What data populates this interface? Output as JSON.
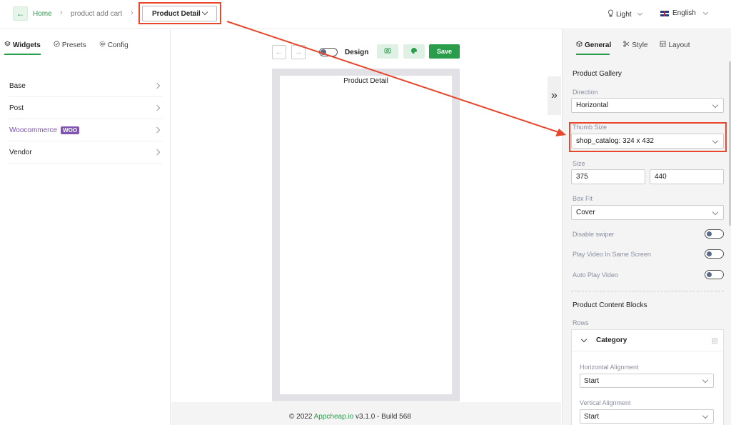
{
  "topbar": {
    "breadcrumb": [
      "Home",
      "product add cart"
    ],
    "page_select": "Product Detail",
    "theme": "Light",
    "language": "English"
  },
  "left": {
    "tabs": [
      "Widgets",
      "Presets",
      "Config"
    ],
    "categories": [
      "Base",
      "Post",
      "Woocommerce",
      "Vendor"
    ],
    "woo_badge": "WOO"
  },
  "center": {
    "design_label": "Design",
    "save_label": "Save",
    "screen_title": "Product Detail",
    "footer": {
      "copyright": "© 2022",
      "brand": "Appcheap.io",
      "version": "v3.1.0 - Build 568"
    }
  },
  "right": {
    "tabs": [
      "General",
      "Style",
      "Layout"
    ],
    "section_title": "Product Gallery",
    "direction_label": "Direction",
    "direction_value": "Horizontal",
    "thumb_label": "Thumb Size",
    "thumb_value": "shop_catalog: 324 x 432",
    "size_label": "Size",
    "size_width": "375",
    "size_height": "440",
    "boxfit_label": "Box Fit",
    "boxfit_value": "Cover",
    "toggles": [
      "Disable swiper",
      "Play Video In Same Screen",
      "Auto Play Video"
    ],
    "blocks_title": "Product Content Blocks",
    "rows_label": "Rows",
    "block": {
      "title": "Category",
      "h_align_label": "Horizontal Alignment",
      "h_align_value": "Start",
      "v_align_label": "Vertical Alignment",
      "v_align_value": "Start"
    }
  },
  "colors": {
    "accent": "#2a9d4b",
    "highlight": "#e8472c",
    "woo": "#7f54b3"
  }
}
